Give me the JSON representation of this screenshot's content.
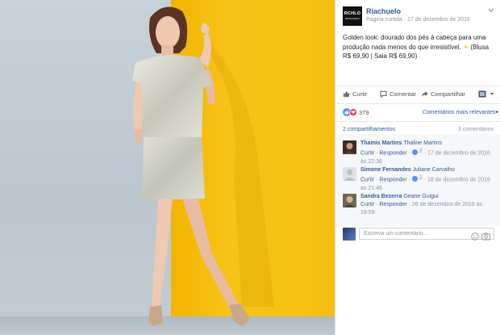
{
  "post": {
    "page_name": "Riachuelo",
    "page_logo_text": "RCHLO",
    "page_logo_sub": "RIACHUELO",
    "category": "Página curtida",
    "date": "17 de dezembro de 2016",
    "separator": "·",
    "text": "Golden look: dourado dos pés à cabeça para uma produção nada menos do que irresistível.",
    "text_suffix": "(Blusa R$ 69,90 | Saia R$ 69,90)",
    "sun_glyph": "☀"
  },
  "actions": {
    "like": "Curtir",
    "comment": "Comentar",
    "share": "Compartilhar"
  },
  "reactions": {
    "count": "379",
    "sort_label": "Comentários mais relevantes",
    "sort_arrow": "▾"
  },
  "stats": {
    "shares": "2 compartilhamentos",
    "comments": "3 comentários"
  },
  "comments": [
    {
      "author": "Thamis Martins",
      "tag": "Thaline Martins",
      "like": "Curtir",
      "reply": "Responder",
      "likes": "2",
      "date": "17 de dezembro de 2016 às 22:36"
    },
    {
      "author": "Simone Fernandes",
      "tag": "Juliane Carvalho",
      "like": "Curtir",
      "reply": "Responder",
      "likes": "2",
      "date": "18 de dezembro de 2016 às 21:46"
    },
    {
      "author": "Sandra Bezerra",
      "tag": "Geane Guigui",
      "like": "Curtir",
      "reply": "Responder",
      "likes": "",
      "date": "26 de dezembro de 2016 às 19:59"
    }
  ],
  "composer": {
    "placeholder": "Escreva um comentário..."
  },
  "icons": {
    "like": "thumbs-up-icon",
    "comment": "speech-bubble-icon",
    "share": "share-arrow-icon",
    "audience": "page-audience-icon",
    "emoji": "emoji-icon",
    "photo": "camera-icon"
  },
  "colors": {
    "link": "#365899",
    "meta": "#90949c",
    "like_blue": "#5890ff",
    "love_red": "#f0284a",
    "backdrop_yellow": "#f5bf12",
    "backdrop_grey": "#c4ccd2"
  }
}
